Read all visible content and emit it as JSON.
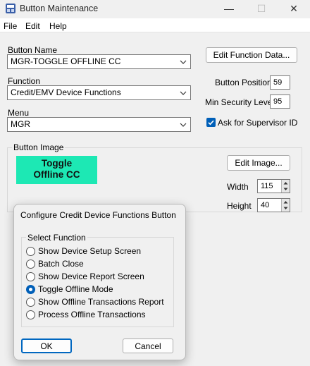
{
  "window": {
    "title": "Button Maintenance",
    "minimize_glyph": "—",
    "maximize_glyph": "☐",
    "close_glyph": "✕"
  },
  "menu": [
    "File",
    "Edit",
    "Help"
  ],
  "form": {
    "button_name_label": "Button Name",
    "button_name_value": "MGR-TOGGLE OFFLINE CC",
    "function_label": "Function",
    "function_value": "Credit/EMV Device Functions",
    "menu_label": "Menu",
    "menu_value": "MGR",
    "edit_function_data_button": "Edit Function Data...",
    "button_position_label": "Button Position",
    "button_position_value": "59",
    "min_security_label": "Min Security Level",
    "min_security_value": "95",
    "ask_supervisor_label": "Ask for Supervisor ID",
    "ask_supervisor_checked": true
  },
  "button_image": {
    "group_label": "Button Image",
    "preview_line1": "Toggle",
    "preview_line2": "Offline CC",
    "preview_color": "#1de8b4",
    "edit_image_button": "Edit Image...",
    "width_label": "Width",
    "width_value": "115",
    "height_label": "Height",
    "height_value": "40"
  },
  "dialog": {
    "title": "Configure Credit Device Functions Button",
    "group_label": "Select Function",
    "options": [
      {
        "label": "Show Device Setup Screen",
        "selected": false
      },
      {
        "label": "Batch Close",
        "selected": false
      },
      {
        "label": "Show Device Report Screen",
        "selected": false
      },
      {
        "label": "Toggle Offline Mode",
        "selected": true
      },
      {
        "label": "Show Offline Transactions Report",
        "selected": false
      },
      {
        "label": "Process Offline Transactions",
        "selected": false
      }
    ],
    "ok_button": "OK",
    "cancel_button": "Cancel"
  },
  "colors": {
    "accent": "#005fb8",
    "window_bg": "#f0f0f0",
    "preview": "#1de8b4"
  }
}
